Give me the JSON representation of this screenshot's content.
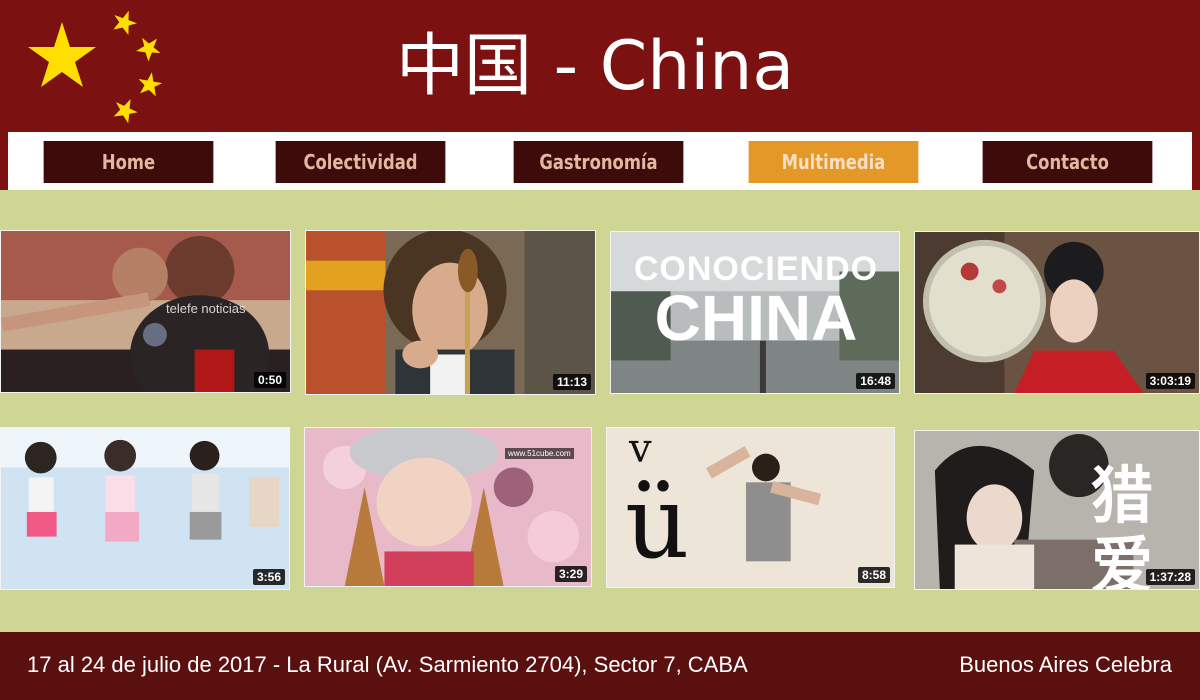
{
  "header": {
    "title": "中国 - China",
    "flag_colors": {
      "field": "#7b1111",
      "stars": "#ffde00"
    }
  },
  "nav": {
    "items": [
      {
        "label": "Home",
        "active": false
      },
      {
        "label": "Colectividad",
        "active": false
      },
      {
        "label": "Gastronomía",
        "active": false
      },
      {
        "label": "Multimedia",
        "active": true
      },
      {
        "label": "Contacto",
        "active": false
      }
    ],
    "active_color": "#e39827"
  },
  "videos": [
    {
      "duration": "0:50",
      "overlay_text": "telefe noticias"
    },
    {
      "duration": "11:13",
      "overlay_text": ""
    },
    {
      "duration": "16:48",
      "overlay_text": "CONOCIENDO CHINA"
    },
    {
      "duration": "3:03:19",
      "overlay_text": ""
    },
    {
      "duration": "3:56",
      "overlay_text": ""
    },
    {
      "duration": "3:29",
      "overlay_text": "www.51cube.com"
    },
    {
      "duration": "8:58",
      "overlay_text": "v ü"
    },
    {
      "duration": "1:37:28",
      "overlay_text": "猎爱"
    }
  ],
  "footer": {
    "event_text": "17 al 24 de julio de 2017 - La Rural (Av. Sarmiento 2704), Sector 7, CABA",
    "brand_text": "Buenos Aires Celebra"
  }
}
